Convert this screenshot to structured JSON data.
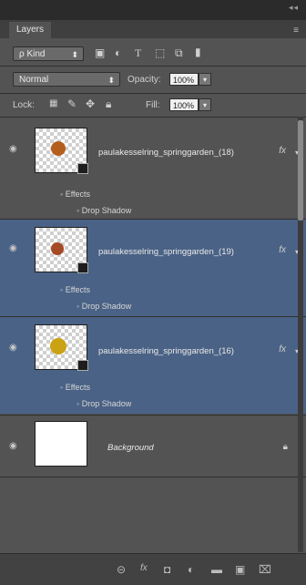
{
  "panel": {
    "tab_label": "Layers",
    "collapse_glyph": "◂◂",
    "menu_glyph": "≡"
  },
  "filter": {
    "kind_label": "ρ Kind",
    "icons": [
      "image-filter-icon",
      "adjustment-filter-icon",
      "type-filter-icon",
      "shape-filter-icon",
      "smartobject-filter-icon",
      "toggle-filter-icon"
    ]
  },
  "blend": {
    "mode": "Normal",
    "opacity_label": "Opacity:",
    "opacity_value": "100%"
  },
  "lock": {
    "label": "Lock:",
    "fill_label": "Fill:",
    "fill_value": "100%"
  },
  "layers": [
    {
      "name": "paulakesselring_springgarden_(18)",
      "selected": false,
      "has_fx": true,
      "effects_label": "Effects",
      "effect_name": "Drop Shadow",
      "flower_color": "#b45e1e"
    },
    {
      "name": "paulakesselring_springgarden_(19)",
      "selected": true,
      "has_fx": true,
      "effects_label": "Effects",
      "effect_name": "Drop Shadow",
      "flower_color": "#a54a25"
    },
    {
      "name": "paulakesselring_springgarden_(16)",
      "selected": true,
      "has_fx": true,
      "effects_label": "Effects",
      "effect_name": "Drop Shadow",
      "flower_color": "#c9a314"
    },
    {
      "name": "Background",
      "selected": false,
      "has_fx": false,
      "locked": true
    }
  ],
  "fx_symbol": "fx",
  "footer": {
    "icons": [
      "link-layers-icon",
      "fx-icon",
      "add-mask-icon",
      "adjustment-layer-icon",
      "new-group-icon",
      "new-layer-icon",
      "trash-icon"
    ],
    "glyphs": [
      "⊝",
      "fx",
      "◘",
      "◐",
      "▬",
      "▣",
      "🗑"
    ]
  },
  "colors": {
    "selection": "#4a6285",
    "panel_bg": "#535353"
  }
}
